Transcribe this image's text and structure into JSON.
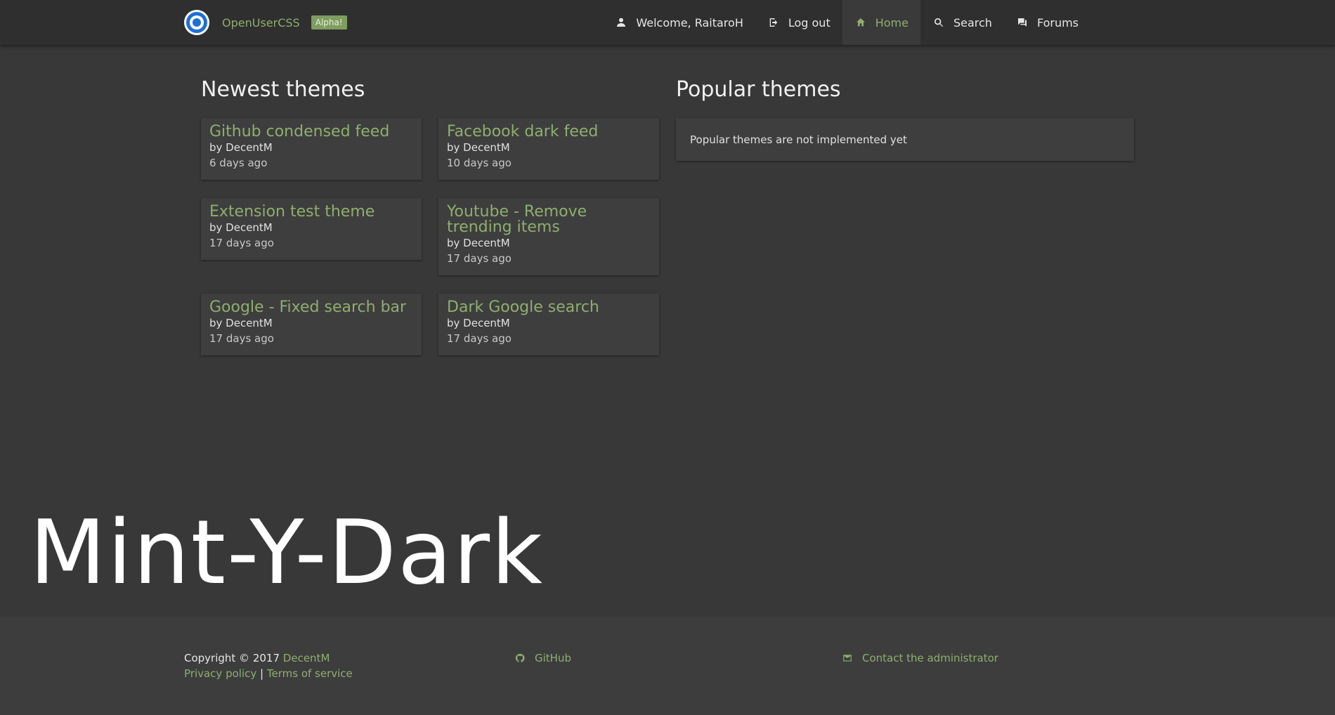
{
  "header": {
    "brand": "OpenUserCSS",
    "badge": "Alpha!",
    "nav": {
      "welcome": "Welcome, RaitaroH",
      "logout": "Log out",
      "home": "Home",
      "search": "Search",
      "forums": "Forums"
    }
  },
  "newest": {
    "title": "Newest themes",
    "themes": [
      {
        "title": "Github condensed feed",
        "author": "by DecentM",
        "time": "6 days ago"
      },
      {
        "title": "Facebook dark feed",
        "author": "by DecentM",
        "time": "10 days ago"
      },
      {
        "title": "Extension test theme",
        "author": "by DecentM",
        "time": "17 days ago"
      },
      {
        "title": "Youtube - Remove trending items",
        "author": "by DecentM",
        "time": "17 days ago"
      },
      {
        "title": "Google - Fixed search bar",
        "author": "by DecentM",
        "time": "17 days ago"
      },
      {
        "title": "Dark Google search",
        "author": "by DecentM",
        "time": "17 days ago"
      }
    ]
  },
  "popular": {
    "title": "Popular themes",
    "message": "Popular themes are not implemented yet"
  },
  "watermark": "Mint-Y-Dark",
  "footer": {
    "copyright": "Copyright © 2017",
    "author": "DecentM",
    "privacy": "Privacy policy",
    "separator": "|",
    "terms": "Terms of service",
    "github": "GitHub",
    "contact": "Contact the administrator"
  },
  "colors": {
    "accent": "#8fae6e",
    "background": "#383838",
    "navbar": "#2f2f2f",
    "card": "#3e3e3e",
    "logo": "#1f6fd6"
  },
  "icons": {
    "welcome": "person-icon",
    "logout": "logout-icon",
    "home": "home-icon",
    "search": "search-icon",
    "forums": "forum-icon",
    "github": "github-icon",
    "contact": "mail-icon"
  }
}
